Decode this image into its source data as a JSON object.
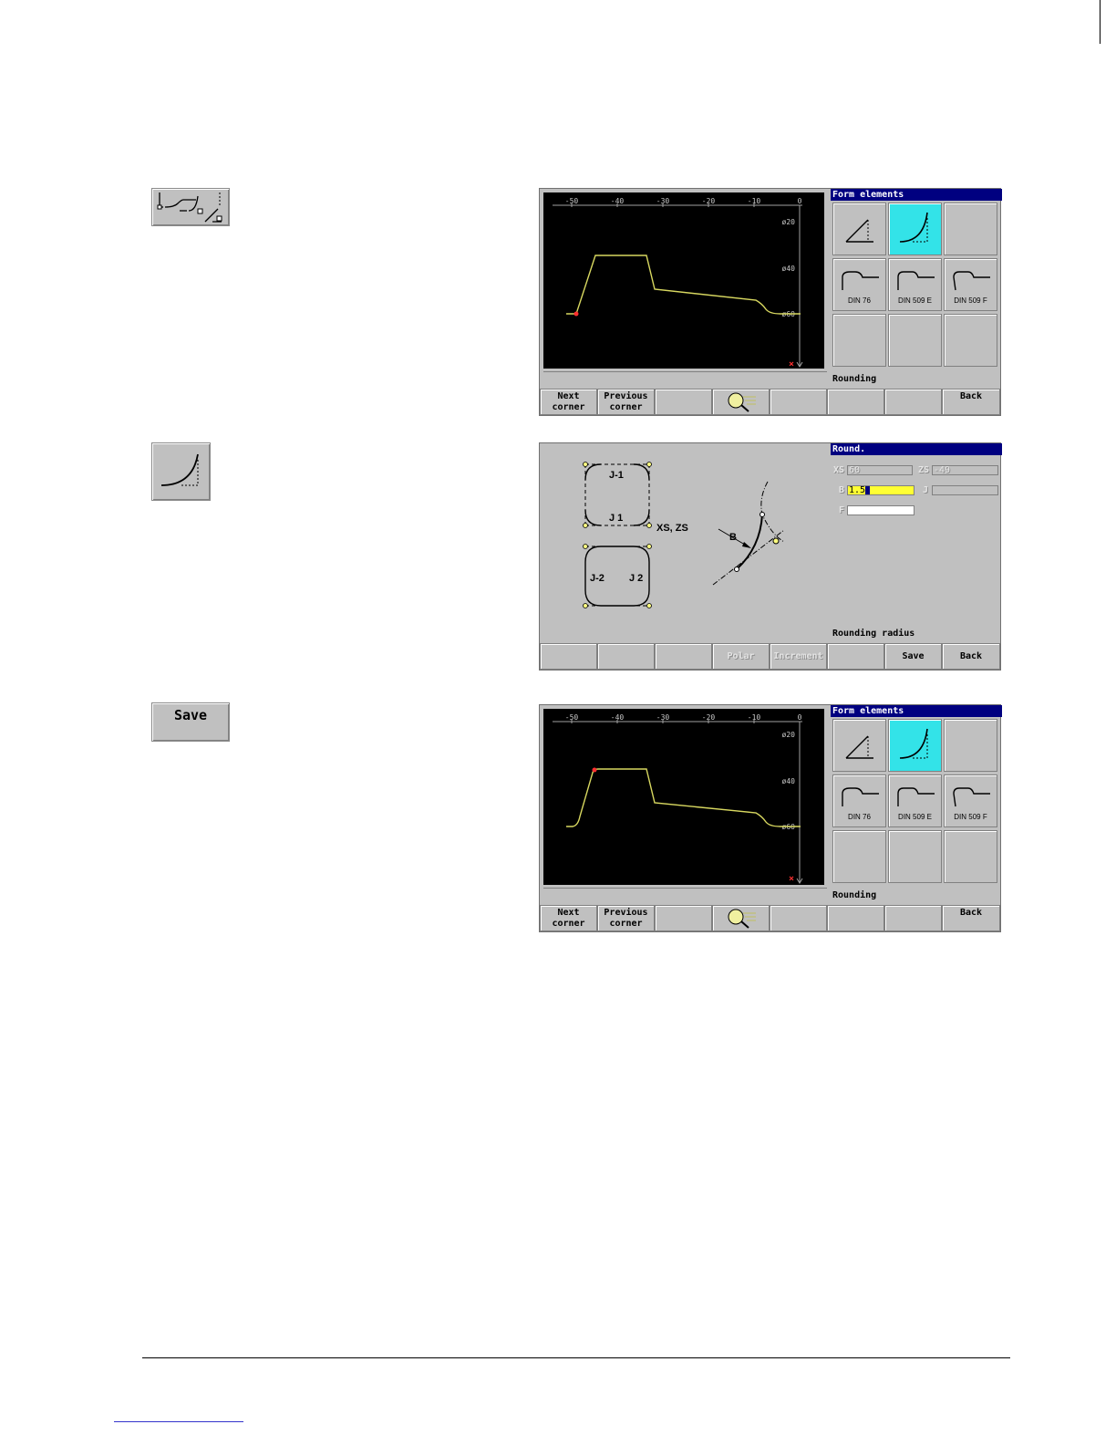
{
  "step1": {
    "icon_name": "contour-form-elements-icon",
    "screen": {
      "axis_x_ticks": [
        "-50",
        "-40",
        "-30",
        "-20",
        "-10",
        "0"
      ],
      "axis_y_ticks": [
        "ø20",
        "ø40",
        "ø60"
      ],
      "panel_title": "Form elements",
      "cells": [
        {
          "icon": "chamfer-icon",
          "label": ""
        },
        {
          "icon": "rounding-icon",
          "label": "",
          "active": true
        },
        {
          "icon": "",
          "label": ""
        },
        {
          "icon": "undercut-din76-icon",
          "label": "DIN 76"
        },
        {
          "icon": "undercut-din509e-icon",
          "label": "DIN 509 E"
        },
        {
          "icon": "undercut-din509f-icon",
          "label": "DIN 509 F"
        },
        {
          "icon": "",
          "label": ""
        },
        {
          "icon": "",
          "label": ""
        },
        {
          "icon": "",
          "label": ""
        }
      ],
      "panel_status": "Rounding",
      "softkeys": {
        "k1a": "Next",
        "k1b": "corner",
        "k2a": "Previous",
        "k2b": "corner",
        "k4_icon": "zoom-magnifier-icon",
        "k8": "Back"
      }
    }
  },
  "step2": {
    "icon_name": "rounding-icon",
    "screen": {
      "figure_labels": {
        "jm1": "J-1",
        "j1": "J 1",
        "jm2": "J-2",
        "j2": "J 2",
        "xszs": "XS, ZS",
        "b": "B"
      },
      "panel_title": "Round.",
      "fields": {
        "xs_label": "XS",
        "xs_value": "60",
        "zs_label": "ZS",
        "zs_value": "-49",
        "b_label": "B",
        "b_value": "1.5",
        "j_label": "J",
        "j_value": "",
        "f_label": "F",
        "f_value": ""
      },
      "panel_status": "Rounding radius",
      "softkeys": {
        "k4": "Polar",
        "k5": "Increment",
        "k7": "Save",
        "k8": "Back"
      }
    }
  },
  "step3": {
    "key_label": "Save",
    "screen": {
      "axis_x_ticks": [
        "-50",
        "-40",
        "-30",
        "-20",
        "-10",
        "0"
      ],
      "axis_y_ticks": [
        "ø20",
        "ø40",
        "ø60"
      ],
      "panel_title": "Form elements",
      "cells": [
        {
          "label": ""
        },
        {
          "label": ""
        },
        {
          "label": ""
        },
        {
          "label": "DIN 76"
        },
        {
          "label": "DIN 509 E"
        },
        {
          "label": "DIN 509 F"
        },
        {
          "label": ""
        },
        {
          "label": ""
        },
        {
          "label": ""
        }
      ],
      "panel_status": "Rounding",
      "softkeys": {
        "k1a": "Next",
        "k1b": "corner",
        "k2a": "Previous",
        "k2b": "corner",
        "k8": "Back"
      }
    }
  },
  "colors": {
    "contour": "#d8d860",
    "highlight": "#33e3e8",
    "title_bar": "#000080",
    "panel": "#c0c0c0"
  }
}
